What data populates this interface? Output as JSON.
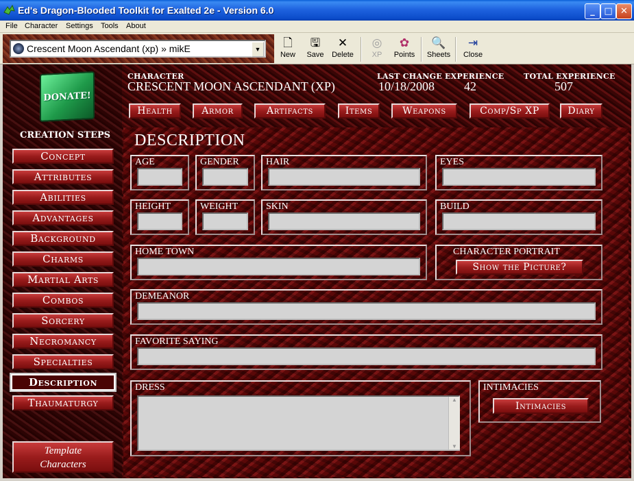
{
  "window": {
    "title": "Ed's Dragon-Blooded Toolkit for Exalted 2e - Version 6.0",
    "controls": [
      "_",
      "□",
      "✕"
    ]
  },
  "menu": [
    "File",
    "Character",
    "Settings",
    "Tools",
    "About"
  ],
  "toolbar": {
    "character_select": "Crescent Moon Ascendant (xp) » mikE",
    "buttons": {
      "new": "New",
      "save": "Save",
      "delete": "Delete",
      "xp": "XP",
      "points": "Points",
      "sheets": "Sheets",
      "close": "Close"
    }
  },
  "header": {
    "character_label": "CHARACTER",
    "character_name": "CRESCENT MOON ASCENDANT (XP)",
    "last_change_label": "LAST CHANGE",
    "last_change": "10/18/2008",
    "experience_label": "EXPERIENCE",
    "experience": "42",
    "total_experience_label": "TOTAL EXPERIENCE",
    "total_experience": "507"
  },
  "donate": "DONATE!",
  "top_tabs": [
    "Health",
    "Armor",
    "Artifacts",
    "Items",
    "Weapons",
    "Comp/Sp XP",
    "Diary"
  ],
  "creation_steps": {
    "title": "CREATION STEPS",
    "items": [
      "Concept",
      "Attributes",
      "Abilities",
      "Advantages",
      "Background",
      "Charms",
      "Martial Arts",
      "Combos",
      "Sorcery",
      "Necromancy",
      "Specialties",
      "Description",
      "Thaumaturgy"
    ],
    "active": "Description"
  },
  "template_button": [
    "Template",
    "Characters"
  ],
  "description": {
    "title": "DESCRIPTION",
    "fields": {
      "age": {
        "label": "AGE",
        "value": ""
      },
      "gender": {
        "label": "GENDER",
        "value": ""
      },
      "hair": {
        "label": "HAIR",
        "value": ""
      },
      "eyes": {
        "label": "EYES",
        "value": ""
      },
      "height": {
        "label": "HEIGHT",
        "value": ""
      },
      "weight": {
        "label": "WEIGHT",
        "value": ""
      },
      "skin": {
        "label": "SKIN",
        "value": ""
      },
      "build": {
        "label": "BUILD",
        "value": ""
      },
      "home_town": {
        "label": "HOME TOWN",
        "value": ""
      },
      "demeanor": {
        "label": "DEMEANOR",
        "value": ""
      },
      "favorite_saying": {
        "label": "FAVORITE SAYING",
        "value": ""
      },
      "dress": {
        "label": "DRESS",
        "value": ""
      }
    },
    "portrait": {
      "label": "CHARACTER PORTRAIT",
      "button": "Show the Picture?"
    },
    "intimacies": {
      "label": "INTIMACIES",
      "button": "Intimacies"
    }
  }
}
